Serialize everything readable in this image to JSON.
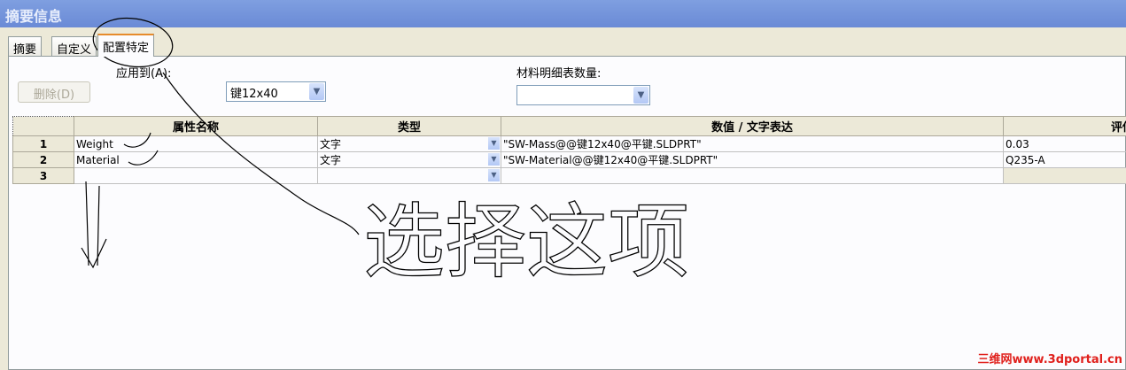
{
  "window": {
    "title": "摘要信息"
  },
  "tabs": [
    {
      "label": "摘要"
    },
    {
      "label": "自定义"
    },
    {
      "label": "配置特定"
    }
  ],
  "apply_to": {
    "label": "应用到(A):",
    "value": "键12x40"
  },
  "bom_qty": {
    "label": "材料明细表数量:",
    "value": ""
  },
  "delete_button": "删除(D)",
  "table": {
    "headers": [
      "属性名称",
      "类型",
      "数值 / 文字表达",
      "评估"
    ],
    "rows": [
      {
        "num": "1",
        "name": "Weight",
        "type": "文字",
        "value": "\"SW-Mass@@键12x40@平键.SLDPRT\"",
        "eval": "0.03"
      },
      {
        "num": "2",
        "name": "Material",
        "type": "文字",
        "value": "\"SW-Material@@键12x40@平键.SLDPRT\"",
        "eval": "Q235-A"
      },
      {
        "num": "3",
        "name": "",
        "type": "",
        "value": "",
        "eval": ""
      }
    ]
  },
  "annotation": "选择这项",
  "watermark": "三维网www.3dportal.cn"
}
